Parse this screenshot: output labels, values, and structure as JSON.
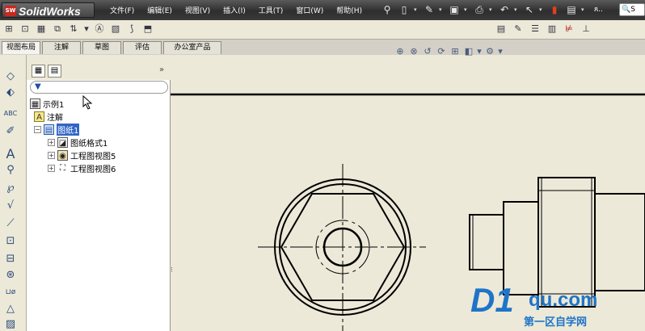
{
  "app": {
    "title": "SolidWorks",
    "logo_mark": "SW",
    "menu": [
      "文件(F)",
      "编辑(E)",
      "视图(V)",
      "插入(I)",
      "工具(T)",
      "窗口(W)",
      "帮助(H)"
    ],
    "top_right_text": "ጸ..",
    "search_placeholder": "S"
  },
  "tabs": [
    "视图布局",
    "注解",
    "草图",
    "评估",
    "办公室产品"
  ],
  "feature_tree": {
    "collapse_label": "»",
    "items": [
      {
        "label": "示例1",
        "icon": "drawing-icon"
      },
      {
        "label": "注解",
        "icon": "annotation-icon"
      },
      {
        "label": "图纸1",
        "icon": "sheet-icon"
      },
      {
        "label": "图纸格式1",
        "icon": "sheet-format-icon"
      },
      {
        "label": "工程图视图5",
        "icon": "drawing-view-icon"
      },
      {
        "label": "工程图视图6",
        "icon": "drawing-view-icon"
      }
    ],
    "selected": "图纸1"
  },
  "watermark": {
    "big": "D1",
    "small": "qu.com",
    "cn": "第一区自学网"
  },
  "colors": {
    "selection": "#3166c6",
    "canvas": "#ece9d8",
    "watermark": "#1f74c8"
  }
}
